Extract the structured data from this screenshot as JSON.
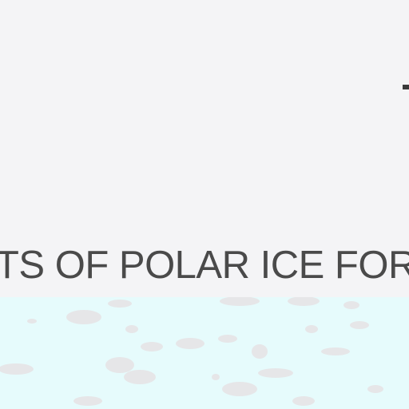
{
  "headline": "TS OF POLAR ICE FOR",
  "colors": {
    "background": "#f4f4f6",
    "text": "#4a4a4a",
    "ice": "#e6fbfc",
    "floe": "#e6e6e8"
  }
}
